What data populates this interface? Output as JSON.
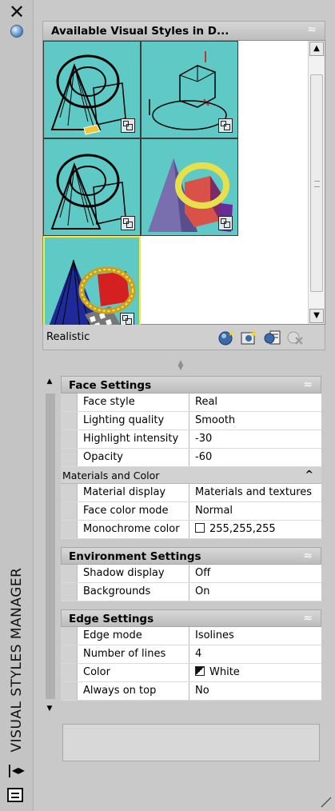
{
  "window": {
    "title": "VISUAL STYLES MANAGER",
    "close_glyph": "✕",
    "autohide_icon": "blue-ball-icon",
    "collapse_glyph": "|◂▸",
    "properties_icon": "properties-list-icon"
  },
  "gallery": {
    "header": "Available Visual Styles in D...",
    "collapse_glyph": "≈",
    "selected_style": "Realistic",
    "thumbnails": [
      {
        "name": "style-3d-wireframe-lit"
      },
      {
        "name": "style-2d-wireframe"
      },
      {
        "name": "style-3d-hidden"
      },
      {
        "name": "style-conceptual"
      },
      {
        "name": "style-realistic",
        "selected": true
      }
    ],
    "tools": [
      {
        "name": "create-new-visual-style-icon"
      },
      {
        "name": "apply-to-viewport-icon"
      },
      {
        "name": "export-to-tool-palette-icon"
      },
      {
        "name": "delete-visual-style-icon"
      }
    ]
  },
  "properties": {
    "sections": [
      {
        "title": "Face Settings",
        "rows": [
          {
            "name": "Face style",
            "value": "Real"
          },
          {
            "name": "Lighting quality",
            "value": "Smooth"
          },
          {
            "name": "Highlight intensity",
            "value": "-30"
          },
          {
            "name": "Opacity",
            "value": "-60"
          }
        ],
        "subsection": {
          "title": "Materials and Color",
          "rows": [
            {
              "name": "Material display",
              "value": "Materials and textures"
            },
            {
              "name": "Face color mode",
              "value": "Normal"
            },
            {
              "name": "Monochrome color",
              "value": "255,255,255",
              "swatch": "white"
            }
          ]
        }
      },
      {
        "title": "Environment Settings",
        "rows": [
          {
            "name": "Shadow display",
            "value": "Off"
          },
          {
            "name": "Backgrounds",
            "value": "On"
          }
        ]
      },
      {
        "title": "Edge Settings",
        "rows": [
          {
            "name": "Edge mode",
            "value": "Isolines"
          },
          {
            "name": "Number of lines",
            "value": "4"
          },
          {
            "name": "Color",
            "value": "White",
            "swatch": "black-white"
          },
          {
            "name": "Always on top",
            "value": "No"
          }
        ]
      }
    ]
  }
}
